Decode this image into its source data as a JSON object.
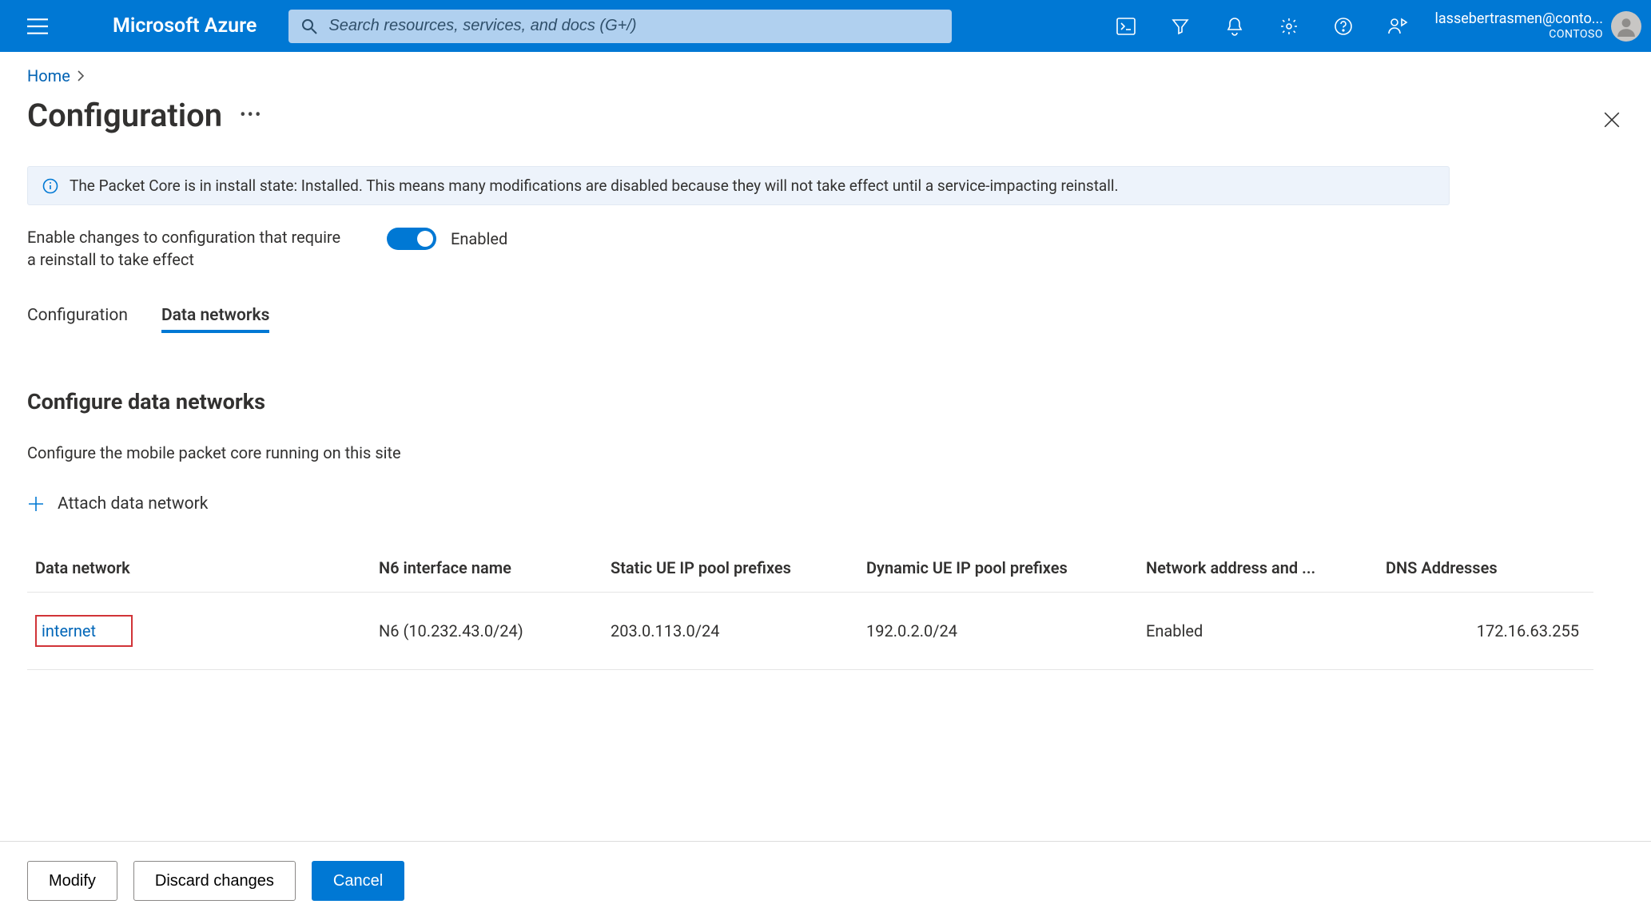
{
  "topbar": {
    "brand": "Microsoft Azure",
    "search_placeholder": "Search resources, services, and docs (G+/)",
    "account_email": "lassebertrasmen@conto...",
    "account_tenant": "CONTOSO"
  },
  "breadcrumb": {
    "home": "Home"
  },
  "page": {
    "title": "Configuration"
  },
  "infobar": {
    "text": "The Packet Core is in install state: Installed. This means many modifications are disabled because they will not take effect until a service-impacting reinstall."
  },
  "toggle": {
    "label": "Enable changes to configuration that require a reinstall to take effect",
    "state": "Enabled"
  },
  "tabs": {
    "configuration": "Configuration",
    "data_networks": "Data networks"
  },
  "section": {
    "heading": "Configure data networks",
    "subtext": "Configure the mobile packet core running on this site",
    "attach": "Attach data network"
  },
  "table": {
    "headers": {
      "name": "Data network",
      "n6": "N6 interface name",
      "static": "Static UE IP pool prefixes",
      "dynamic": "Dynamic UE IP pool prefixes",
      "nat": "Network address and ...",
      "dns": "DNS Addresses"
    },
    "rows": [
      {
        "name": "internet",
        "n6": "N6 (10.232.43.0/24)",
        "static": "203.0.113.0/24",
        "dynamic": "192.0.2.0/24",
        "nat": "Enabled",
        "dns": "172.16.63.255"
      }
    ]
  },
  "footer": {
    "modify": "Modify",
    "discard": "Discard changes",
    "cancel": "Cancel"
  }
}
